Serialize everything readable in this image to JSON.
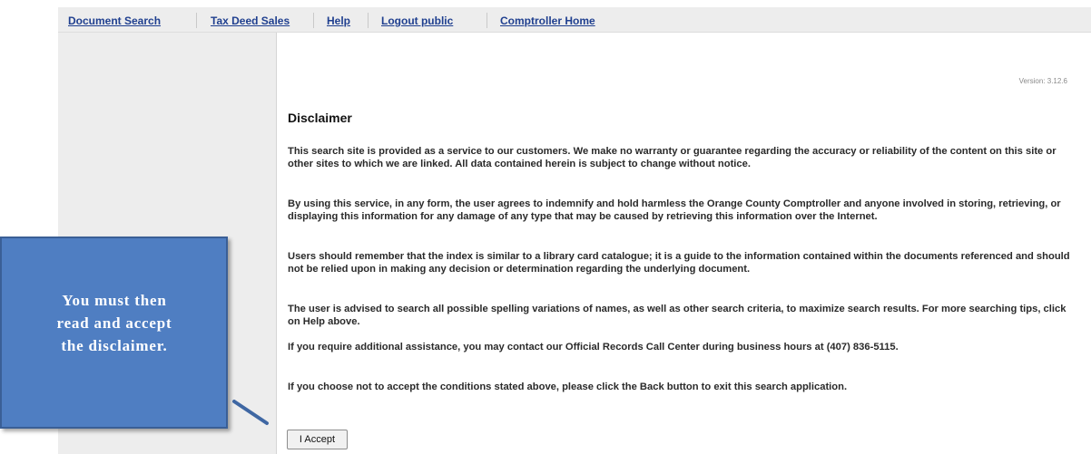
{
  "nav": {
    "items": [
      "Document Search",
      "Tax Deed Sales",
      "Help",
      "Logout public",
      "Comptroller Home"
    ],
    "link_color": "#1f3f8f"
  },
  "version": "Version: 3.12.6",
  "disclaimer": {
    "title": "Disclaimer",
    "paragraphs": [
      "This search site is provided as a service to our customers. We make no warranty or guarantee regarding the accuracy or reliability of the content on this site or other sites to which we are linked. All data contained herein is subject to change without notice.",
      "By using this service, in any form, the user agrees to indemnify and hold harmless the Orange County Comptroller and anyone involved in storing, retrieving, or displaying this information for any damage of any type that may be caused by retrieving this information over the Internet.",
      "Users should remember that the index is similar to a library card catalogue; it is a guide to the information contained within the documents referenced and should not be relied upon in making any decision or determination regarding the underlying document.",
      "The user is advised to search all possible spelling variations of names, as well as other search criteria, to maximize search results. For more searching tips, click on Help above.",
      "If you require additional assistance, you may contact our Official Records Call Center during business hours at (407) 836-5115.",
      "If you choose not to accept the conditions stated above, please click the Back button to exit this search application."
    ],
    "accept_label": "I Accept"
  },
  "callout": {
    "lines": [
      "You must then",
      "read and accept",
      "the disclaimer."
    ],
    "fill_color": "#4f7ec2"
  }
}
